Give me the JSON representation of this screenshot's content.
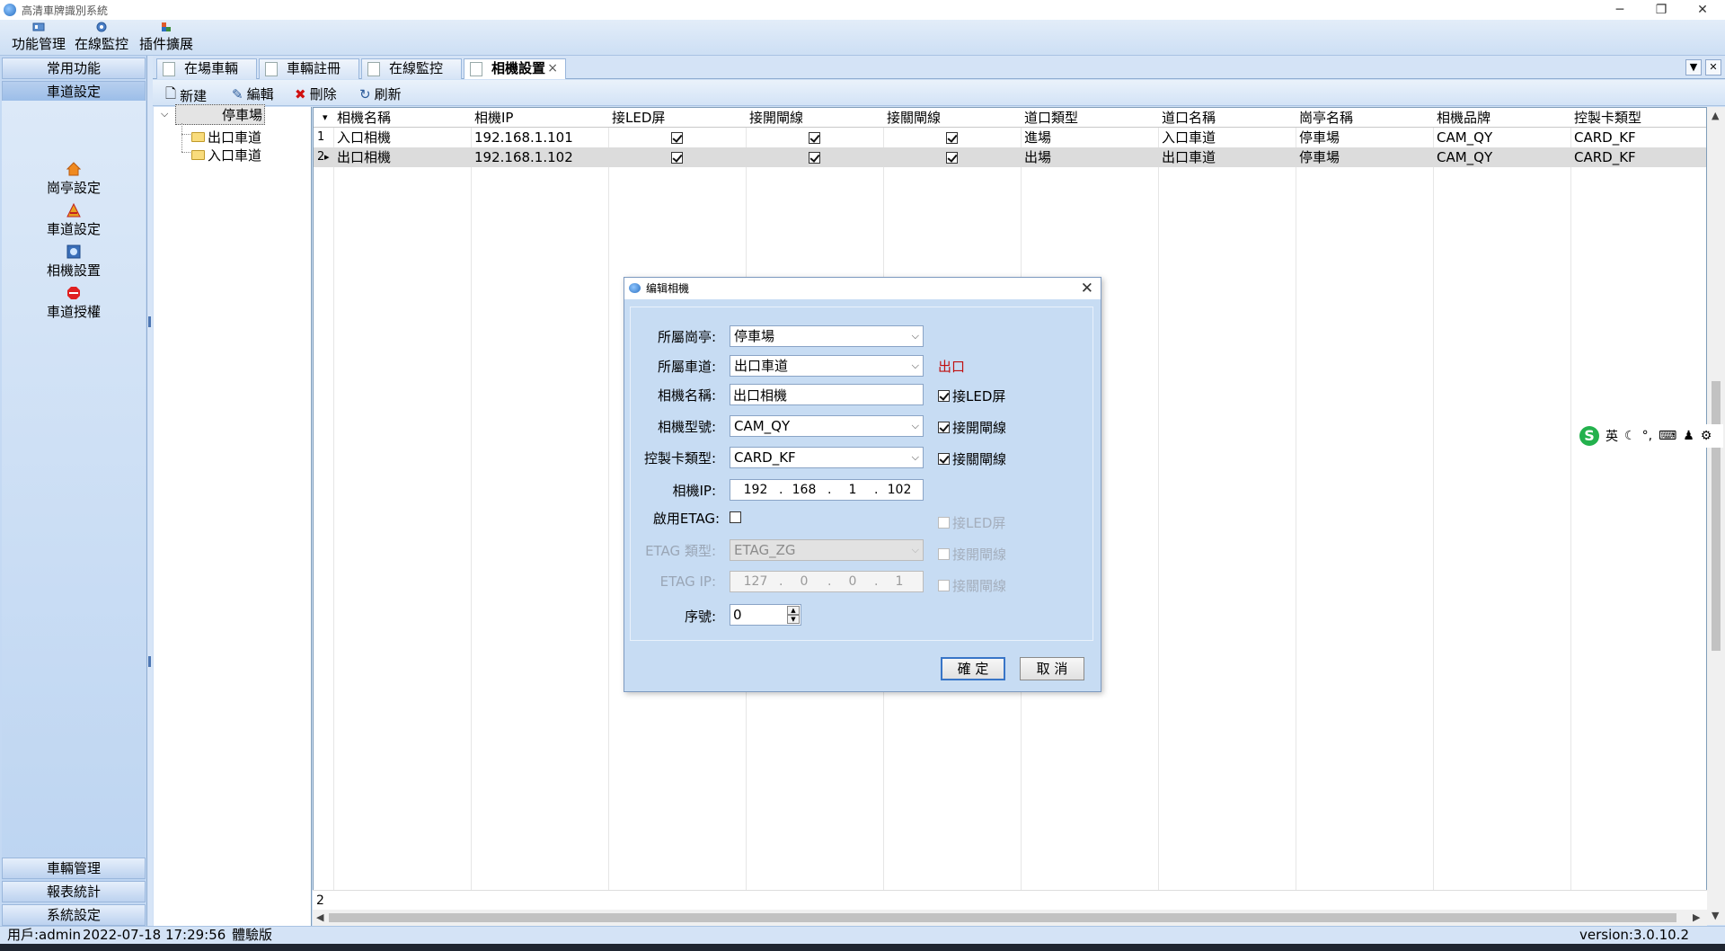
{
  "window": {
    "title": "高清車牌識別系統",
    "minimize": "─",
    "restore": "❐",
    "close": "✕"
  },
  "menu": {
    "items": [
      "功能管理",
      "在線監控",
      "插件擴展"
    ]
  },
  "nav": {
    "top_sections": [
      "常用功能",
      "車道設定"
    ],
    "items": [
      "崗亭設定",
      "車道設定",
      "相機設置",
      "車道授權"
    ],
    "bottom_sections": [
      "車輛管理",
      "報表統計",
      "系統設定"
    ]
  },
  "tabs": [
    {
      "label": "在場車輛"
    },
    {
      "label": "車輛註冊"
    },
    {
      "label": "在線監控"
    },
    {
      "label": "相機設置",
      "close": "×"
    }
  ],
  "tab_buttons": {
    "dropdown": "▼",
    "close": "✕"
  },
  "toolbar": {
    "new": "新建",
    "edit": "編輯",
    "delete": "刪除",
    "refresh": "刷新",
    "new_icon": "🗋",
    "edit_icon": "✎",
    "delete_icon": "✖",
    "refresh_icon": "↻"
  },
  "tree": {
    "root": "停車場",
    "children": [
      "出口車道",
      "入口車道"
    ],
    "expander": "⌵"
  },
  "grid": {
    "sort_glyph": "▾",
    "columns": [
      "相機名稱",
      "相機IP",
      "接LED屏",
      "接開閘線",
      "接關閘線",
      "道口類型",
      "道口名稱",
      "崗亭名稱",
      "相機品牌",
      "控製卡類型"
    ],
    "rows": [
      {
        "num": "1",
        "marker": "",
        "name": "入口相機",
        "ip": "192.168.1.101",
        "led": true,
        "open": true,
        "close": true,
        "type": "進場",
        "lane": "入口車道",
        "booth": "停車場",
        "brand": "CAM_QY",
        "card": "CARD_KF"
      },
      {
        "num": "2",
        "marker": "▸",
        "name": "出口相機",
        "ip": "192.168.1.102",
        "led": true,
        "open": true,
        "close": true,
        "type": "出場",
        "lane": "出口車道",
        "booth": "停車場",
        "brand": "CAM_QY",
        "card": "CARD_KF"
      }
    ],
    "footer_count": "2",
    "scroll_up": "▲",
    "scroll_down": "▼",
    "scroll_left": "◀",
    "scroll_right": "▶"
  },
  "ime": {
    "logo": "S",
    "lang": "英",
    "icons": [
      "☾",
      "°,",
      "⌨",
      "♟",
      "⚙"
    ]
  },
  "dialog": {
    "title": "编辑相機",
    "close": "✕",
    "booth_label": "所屬崗亭:",
    "booth_value": "停車場",
    "lane_label": "所屬車道:",
    "lane_value": "出口車道",
    "lane_direction": "出口",
    "name_label": "相機名稱:",
    "name_value": "出口相機",
    "model_label": "相機型號:",
    "model_value": "CAM_QY",
    "card_label": "控製卡類型:",
    "card_value": "CARD_KF",
    "ip_label": "相機IP:",
    "ip": [
      "192",
      "168",
      "1",
      "102"
    ],
    "etag_enable_label": "啟用ETAG:",
    "etag_type_label": "ETAG 類型:",
    "etag_type_value": "ETAG_ZG",
    "etag_ip_label": "ETAG IP:",
    "etag_ip": [
      "127",
      "0",
      "0",
      "1"
    ],
    "seq_label": "序號:",
    "seq_value": "0",
    "led_label": "接LED屏",
    "open_label": "接開閘線",
    "close_label": "接關閘線",
    "etag_led_label": "接LED屏",
    "etag_open_label": "接開閘線",
    "etag_close_label": "接關閘線",
    "ok": "確 定",
    "cancel": "取 消",
    "dropdown_glyph": "⌵",
    "spin_up": "▲",
    "spin_down": "▼",
    "ip_dot": "."
  },
  "status": {
    "user": "用戶:admin",
    "datetime": "2022-07-18 17:29:56",
    "edition": "體驗版",
    "version": "version:3.0.10.2"
  },
  "colors": {
    "accent": "#3875c7",
    "direction_red": "#c01010",
    "nav_bg": "#c4d9f3"
  }
}
